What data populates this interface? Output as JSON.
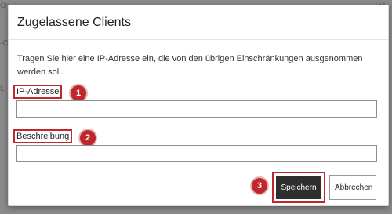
{
  "dialog": {
    "title": "Zugelassene Clients",
    "description": "Tragen Sie hier eine IP-Adresse ein, die von den übrigen Einschränkungen ausgenommen werden soll.",
    "fields": {
      "ip_label": "IP-Adresse",
      "ip_value": "",
      "description_label": "Beschreibung",
      "description_value": ""
    },
    "buttons": {
      "save": "Speichern",
      "cancel": "Abbrechen"
    },
    "callouts": [
      "1",
      "2",
      "3"
    ]
  },
  "background": {
    "fragments": [
      "Ch",
      "-C",
      "Li",
      "t4"
    ]
  },
  "colors": {
    "callout_red": "#c0272d",
    "primary_button": "#2e2e2e"
  }
}
